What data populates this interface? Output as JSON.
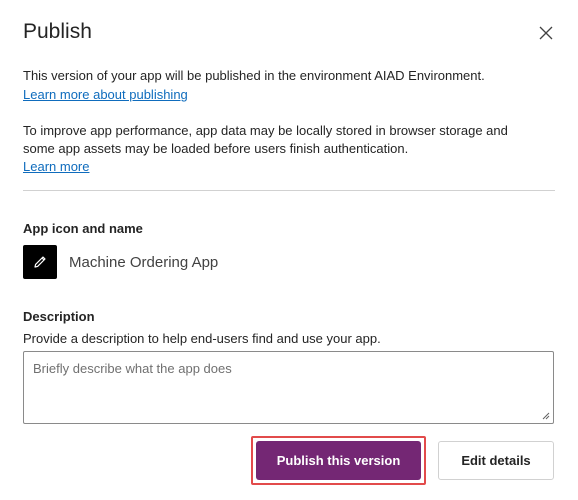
{
  "dialog": {
    "title": "Publish",
    "close_icon": "close-icon"
  },
  "intro": {
    "environment_text": "This version of your app will be published in the environment AIAD Environment.",
    "learn_publishing_link": "Learn more about publishing",
    "performance_text_line1": "To improve app performance, app data may be locally stored in browser storage and",
    "performance_text_line2": "some app assets may be loaded before users finish authentication.",
    "learn_more_link": "Learn more"
  },
  "app_section": {
    "label": "App icon and name",
    "icon": "pencil-icon",
    "app_name": "Machine Ordering App"
  },
  "description_section": {
    "label": "Description",
    "help_text": "Provide a description to help end-users find and use your app.",
    "placeholder": "Briefly describe what the app does",
    "value": ""
  },
  "actions": {
    "publish_label": "Publish this version",
    "edit_label": "Edit details"
  },
  "colors": {
    "primary": "#742774",
    "link": "#0f6cbd",
    "highlight": "#e24b4b"
  }
}
